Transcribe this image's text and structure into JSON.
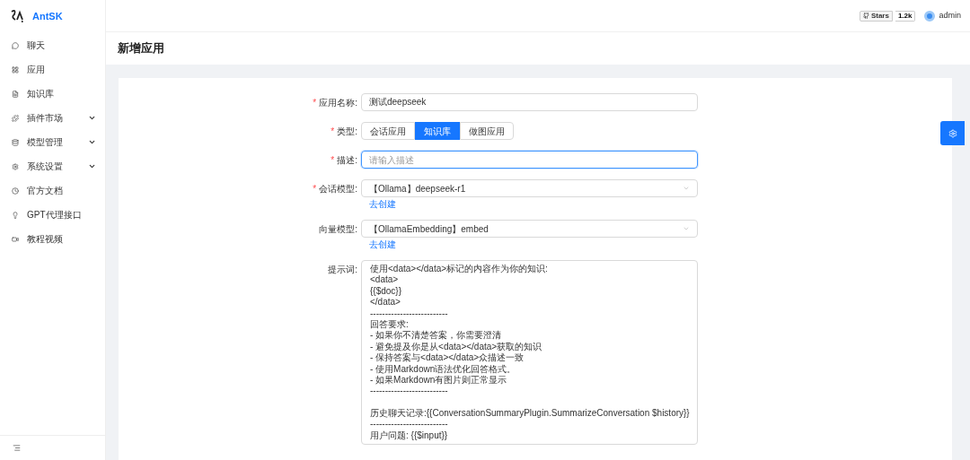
{
  "brand": {
    "name": "AntSK"
  },
  "header": {
    "stars_label": "Stars",
    "stars_count": "1.2k",
    "user": "admin"
  },
  "sidebar": {
    "items": [
      {
        "label": "聊天",
        "expandable": false
      },
      {
        "label": "应用",
        "expandable": false
      },
      {
        "label": "知识库",
        "expandable": false
      },
      {
        "label": "插件市场",
        "expandable": true
      },
      {
        "label": "模型管理",
        "expandable": true
      },
      {
        "label": "系统设置",
        "expandable": true
      },
      {
        "label": "官方文档",
        "expandable": false
      },
      {
        "label": "GPT代理接口",
        "expandable": false
      },
      {
        "label": "教程视频",
        "expandable": false
      }
    ]
  },
  "page": {
    "title": "新增应用"
  },
  "form": {
    "fields": [
      {
        "kind": "text",
        "label": "应用名称:",
        "required_mark": "*",
        "value": "测试deepseek"
      },
      {
        "kind": "segmented",
        "label": "类型:",
        "required_mark": "*",
        "options": [
          {
            "label": "会话应用",
            "selected": false
          },
          {
            "label": "知识库",
            "selected": true
          },
          {
            "label": "做图应用",
            "selected": false
          }
        ]
      },
      {
        "kind": "text",
        "label": "描述:",
        "required_mark": "*",
        "placeholder": "请输入描述",
        "focused": true
      },
      {
        "kind": "select",
        "label": "会话模型:",
        "required_mark": "*",
        "value": "【Ollama】deepseek-r1",
        "link": "去创建"
      },
      {
        "kind": "select",
        "label": "向量模型:",
        "value": "【OllamaEmbedding】embed",
        "link": "去创建"
      },
      {
        "kind": "textarea",
        "label": "提示词:",
        "lines": [
          {
            "kind": "text",
            "text": "使用<data></data>标记的内容作为你的知识:"
          },
          {
            "kind": "text",
            "text": "<data>"
          },
          {
            "kind": "text",
            "text": "{{$doc}}"
          },
          {
            "kind": "text",
            "text": "</data>"
          },
          {
            "kind": "text",
            "text": "--------------------------"
          },
          {
            "kind": "text",
            "text": "回答要求:"
          },
          {
            "kind": "text",
            "text": "- 如果你不清楚答案，你需要澄清"
          },
          {
            "kind": "text",
            "text": "- 避免提及你是从<data></data>获取的知识"
          },
          {
            "kind": "text",
            "text": "- 保持答案与<data></data>众描述一致"
          },
          {
            "kind": "text",
            "text": "- 使用Markdown语法优化回答格式。"
          },
          {
            "kind": "text",
            "text": "- 如果Markdown有图片则正常显示"
          },
          {
            "kind": "text",
            "text": "--------------------------"
          },
          {
            "kind": "blank"
          },
          {
            "kind": "text",
            "text": "历史聊天记录:{{ConversationSummaryPlugin.SummarizeConversation $history}}"
          },
          {
            "kind": "text",
            "text": "--------------------------"
          },
          {
            "kind": "text",
            "text": "用户问题: {{$input}}"
          }
        ]
      }
    ]
  }
}
